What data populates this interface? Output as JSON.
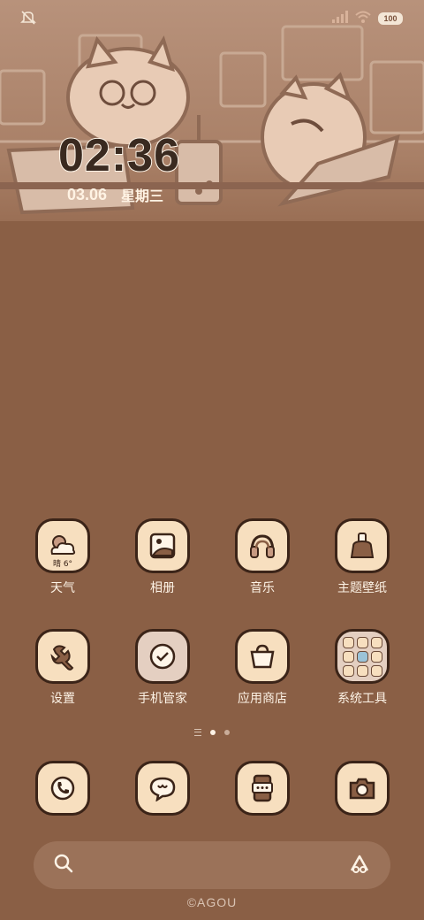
{
  "status_bar": {
    "left_icon": "mute-icon",
    "battery": "100"
  },
  "lockclock": {
    "time": "02:36",
    "date": "03.06",
    "weekday": "星期三"
  },
  "apps": [
    {
      "label": "天气",
      "icon": "weather-icon",
      "sub": "晴 6°"
    },
    {
      "label": "相册",
      "icon": "gallery-icon"
    },
    {
      "label": "音乐",
      "icon": "music-icon"
    },
    {
      "label": "主题壁纸",
      "icon": "theme-icon"
    },
    {
      "label": "设置",
      "icon": "settings-icon"
    },
    {
      "label": "手机管家",
      "icon": "phone-manager-icon"
    },
    {
      "label": "应用商店",
      "icon": "app-store-icon"
    },
    {
      "label": "系统工具",
      "icon": "system-tools-folder-icon"
    }
  ],
  "dock": [
    {
      "icon": "phone-icon"
    },
    {
      "icon": "messages-icon"
    },
    {
      "icon": "device-icon"
    },
    {
      "icon": "camera-icon"
    }
  ],
  "search": {
    "icon": "search-icon",
    "assistant_icon": "assistant-icon"
  },
  "watermark": "©AGOU",
  "colors": {
    "background": "#8a5f45",
    "tile": "#f7dfbf",
    "outline": "#3b2418",
    "text": "#fdf3e6"
  }
}
